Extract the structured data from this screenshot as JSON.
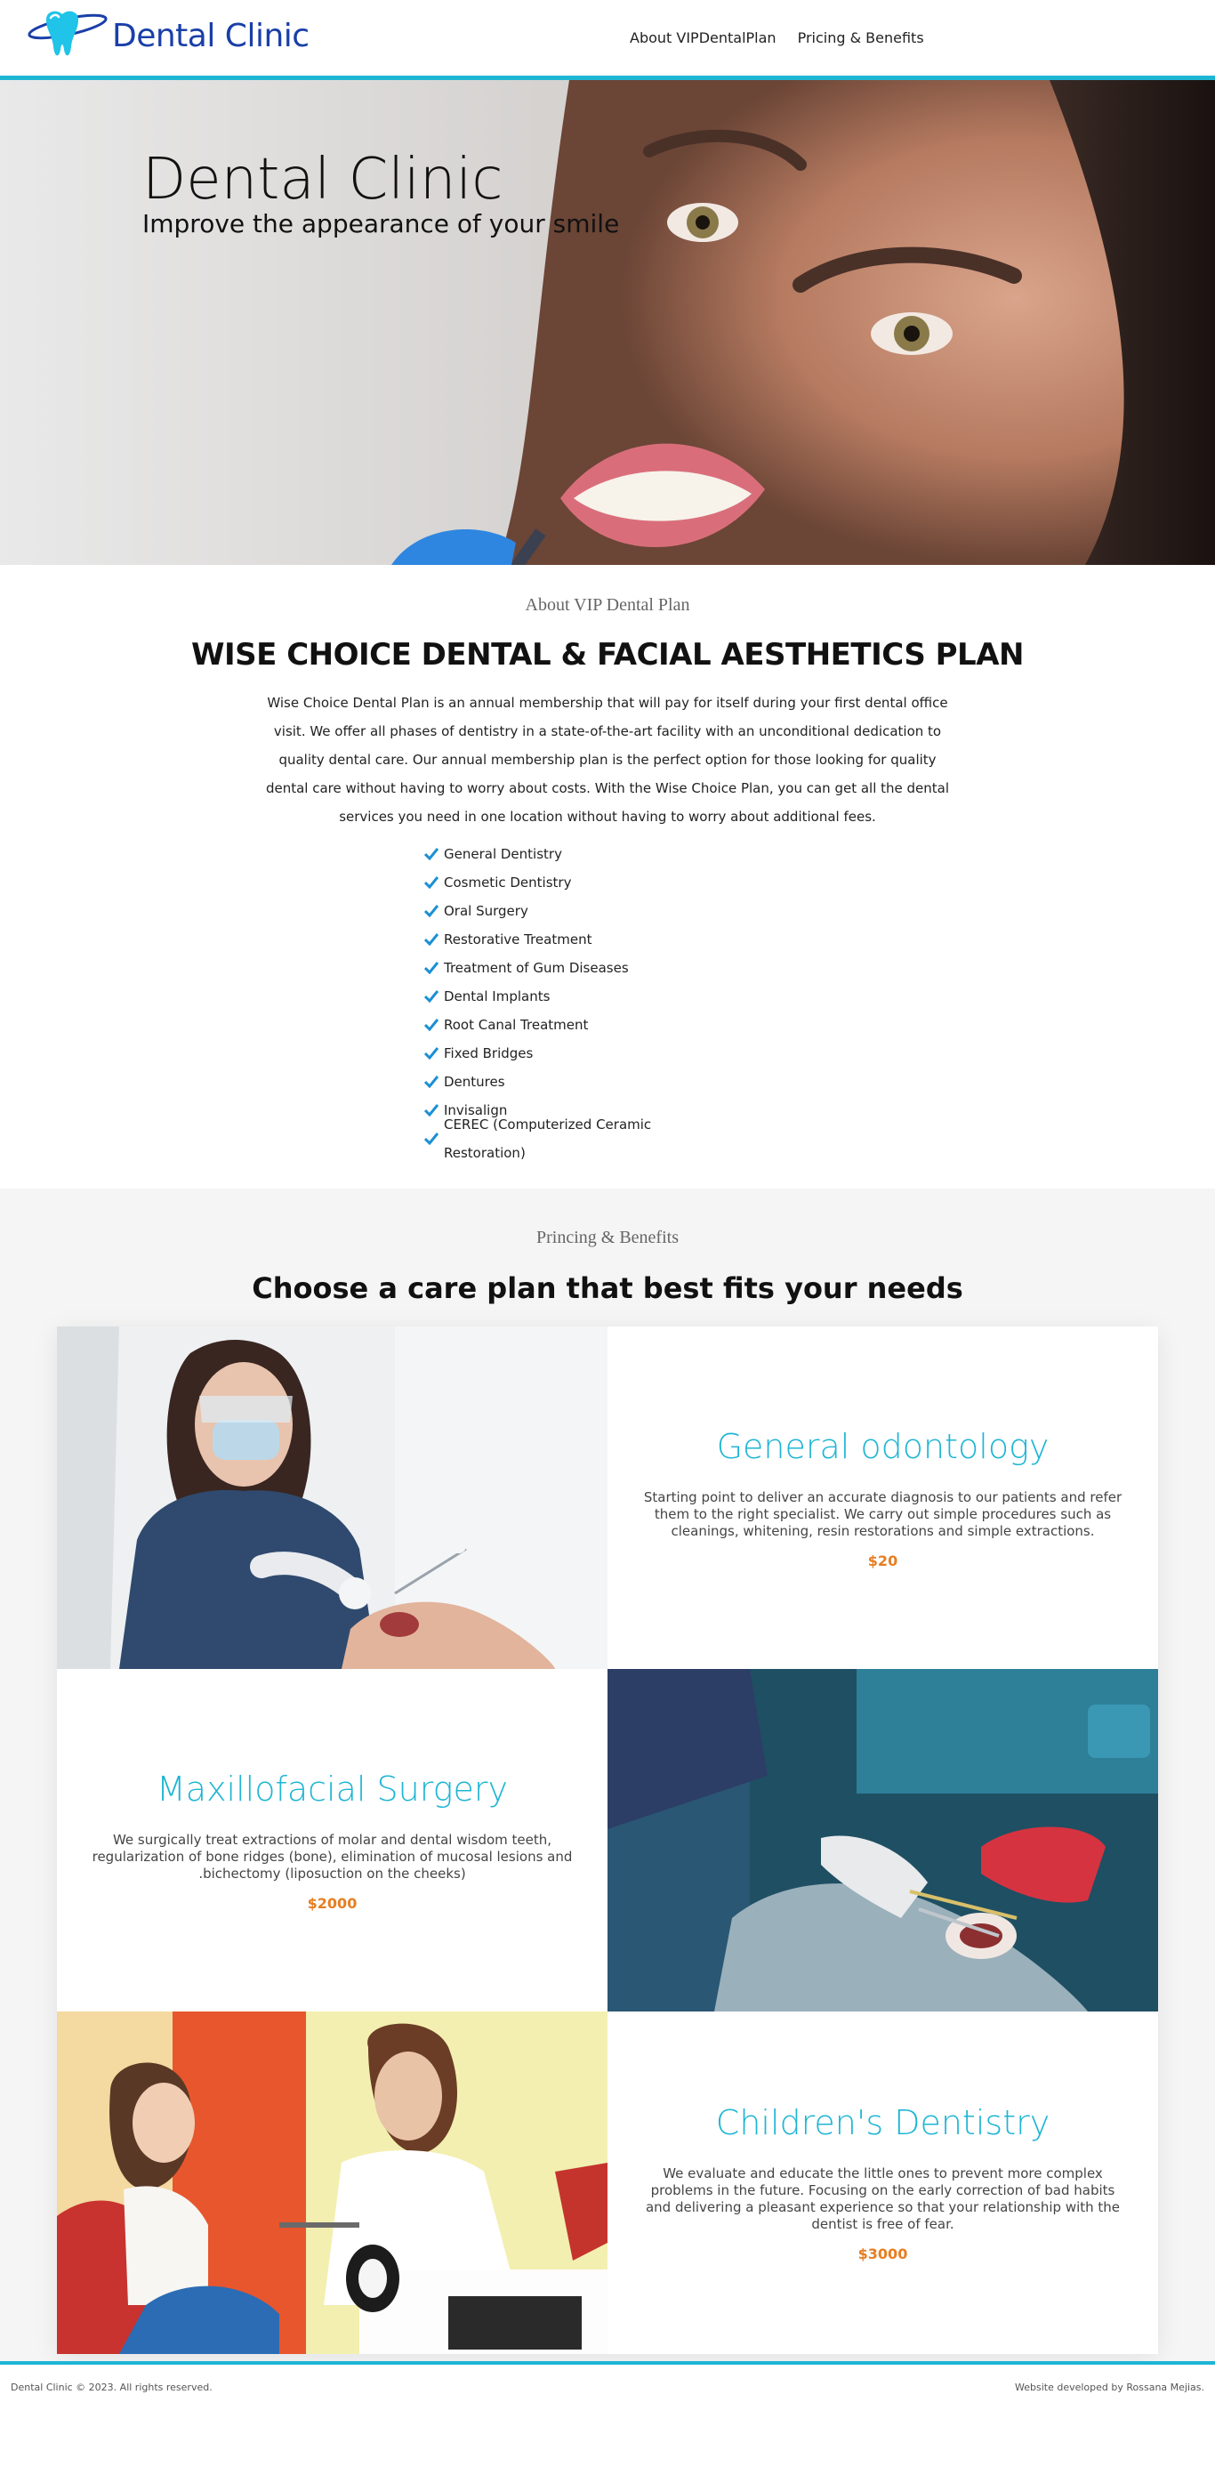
{
  "header": {
    "brand": "Dental Clinic",
    "nav": [
      {
        "label": "About VIPDentalPlan"
      },
      {
        "label": "Pricing & Benefits"
      }
    ]
  },
  "hero": {
    "title": "Dental Clinic",
    "subtitle": "Improve the appearance of your smile"
  },
  "about": {
    "kicker": "About VIP Dental Plan",
    "heading": "WISE CHOICE DENTAL & FACIAL AESTHETICS PLAN",
    "body": "Wise Choice Dental Plan is an annual membership that will pay for itself during your first dental office visit. We offer all phases of dentistry in a state-of-the-art facility with an unconditional dedication to quality dental care. Our annual membership plan is the perfect option for those looking for quality dental care without having to worry about costs. With the Wise Choice Plan, you can get all the dental services you need in one location without having to worry about additional fees.",
    "services": [
      "General Dentistry",
      "Cosmetic Dentistry",
      "Oral Surgery",
      "Restorative Treatment",
      "Treatment of Gum Diseases",
      "Dental Implants",
      "Root Canal Treatment",
      "Fixed Bridges",
      "Dentures",
      "Invisalign",
      "CEREC (Computerized Ceramic Restoration)"
    ]
  },
  "pricing": {
    "kicker": "Princing & Benefits",
    "heading": "Choose a care plan that best fits your needs",
    "plans": [
      {
        "title": "General odontology",
        "description": "Starting point to deliver an accurate diagnosis to our patients and refer them to the right specialist. We carry out simple procedures such as cleanings, whitening, resin restorations and simple extractions.",
        "price": "$20"
      },
      {
        "title": "Maxillofacial Surgery",
        "description": "We surgically treat extractions of molar and dental wisdom teeth, regularization of bone ridges (bone), elimination of mucosal lesions and .bichectomy (liposuction on the cheeks)",
        "price": "$2000"
      },
      {
        "title": "Children's Dentistry",
        "description": "We evaluate and educate the little ones to prevent more complex problems in the future. Focusing on the early correction of bad habits and delivering a pleasant experience so that your relationship with the dentist is free of fear.",
        "price": "$3000"
      }
    ]
  },
  "footer": {
    "copyright": "Dental Clinic © 2023. All rights reserved.",
    "credit": "Website developed by Rossana Mejias."
  },
  "colors": {
    "accent": "#1eb5d4",
    "brand": "#1a3fa8",
    "price": "#e67e22",
    "check": "#1a8fd4"
  }
}
